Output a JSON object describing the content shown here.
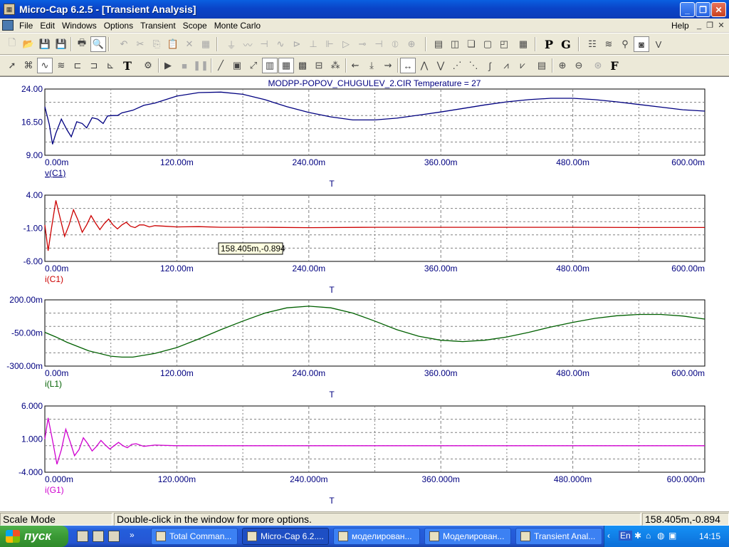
{
  "window": {
    "title": "Micro-Cap 6.2.5 - [Transient Analysis]",
    "app_icon": "microcap-app-icon",
    "controls": [
      "minimize-icon",
      "restore-icon",
      "close-icon"
    ]
  },
  "menu": {
    "items": [
      "File",
      "Edit",
      "Windows",
      "Options",
      "Transient",
      "Scope",
      "Monte Carlo"
    ],
    "help": "Help",
    "mdi_controls": [
      "minimize-icon",
      "restore-icon",
      "close-icon"
    ]
  },
  "toolbar1": {
    "letters": [
      "P",
      "G"
    ]
  },
  "toolbar2": {
    "letters": [
      "T",
      "F"
    ]
  },
  "plot": {
    "title": "MODPP-POPOV_CHUGULEV_2.CIR Temperature = 27",
    "tooltip": "158.405m,-0.894",
    "background": "#ffffff",
    "grid_color": "#808080",
    "axis_label_color": "#000080"
  },
  "chart_data": [
    {
      "type": "line",
      "series": [
        {
          "name": "v(C1)",
          "color": "#000080"
        }
      ],
      "x_label": "T",
      "x_ticks": [
        "0.00m",
        "120.00m",
        "240.00m",
        "360.00m",
        "480.00m",
        "600.00m"
      ],
      "y_ticks": [
        "24.00",
        "16.50",
        "9.00"
      ],
      "xlim": [
        0,
        600
      ],
      "ylim": [
        9,
        24
      ],
      "points": [
        [
          0,
          20
        ],
        [
          4,
          16
        ],
        [
          7,
          11.5
        ],
        [
          10,
          14
        ],
        [
          15,
          17.2
        ],
        [
          20,
          14.8
        ],
        [
          24,
          13.2
        ],
        [
          29,
          16.6
        ],
        [
          34,
          16.2
        ],
        [
          38,
          15.2
        ],
        [
          43,
          17.5
        ],
        [
          48,
          17.2
        ],
        [
          53,
          16.2
        ],
        [
          57,
          17.9
        ],
        [
          62,
          18
        ],
        [
          66,
          18
        ],
        [
          70,
          18.6
        ],
        [
          80,
          19.2
        ],
        [
          90,
          20.3
        ],
        [
          100,
          20.8
        ],
        [
          120,
          22.4
        ],
        [
          140,
          23.2
        ],
        [
          160,
          23.3
        ],
        [
          180,
          22.8
        ],
        [
          200,
          21.6
        ],
        [
          220,
          20
        ],
        [
          240,
          18.7
        ],
        [
          260,
          17.7
        ],
        [
          280,
          17
        ],
        [
          300,
          17
        ],
        [
          320,
          17.4
        ],
        [
          340,
          18.1
        ],
        [
          360,
          18.8
        ],
        [
          380,
          19.6
        ],
        [
          400,
          20.4
        ],
        [
          420,
          21.1
        ],
        [
          440,
          21.6
        ],
        [
          460,
          21.9
        ],
        [
          480,
          21.9
        ],
        [
          500,
          21.6
        ],
        [
          520,
          21.1
        ],
        [
          540,
          20.5
        ],
        [
          560,
          19.9
        ],
        [
          580,
          19.3
        ],
        [
          600,
          19
        ]
      ]
    },
    {
      "type": "line",
      "series": [
        {
          "name": "i(C1)",
          "color": "#cc0000"
        }
      ],
      "x_label": "T",
      "x_ticks": [
        "0.00m",
        "120.00m",
        "240.00m",
        "360.00m",
        "480.00m",
        "600.00m"
      ],
      "y_ticks": [
        "4.00",
        "-1.00",
        "-6.00"
      ],
      "xlim": [
        0,
        600
      ],
      "ylim": [
        -6,
        4
      ],
      "points": [
        [
          0,
          -0.5
        ],
        [
          3,
          -4.4
        ],
        [
          6,
          -1
        ],
        [
          10,
          3.2
        ],
        [
          14,
          0.5
        ],
        [
          18,
          -2.2
        ],
        [
          22,
          -0.5
        ],
        [
          26,
          1.8
        ],
        [
          30,
          0.3
        ],
        [
          34,
          -1.6
        ],
        [
          38,
          -0.5
        ],
        [
          42,
          0.9
        ],
        [
          46,
          -0.2
        ],
        [
          50,
          -1.2
        ],
        [
          54,
          -0.3
        ],
        [
          58,
          0.4
        ],
        [
          62,
          -0.5
        ],
        [
          66,
          -1.1
        ],
        [
          70,
          -0.5
        ],
        [
          74,
          -0.1
        ],
        [
          78,
          -0.7
        ],
        [
          82,
          -0.9
        ],
        [
          86,
          -0.5
        ],
        [
          90,
          -0.5
        ],
        [
          95,
          -0.8
        ],
        [
          100,
          -0.6
        ],
        [
          110,
          -0.7
        ],
        [
          120,
          -0.8
        ],
        [
          140,
          -0.75
        ],
        [
          160,
          -0.85
        ],
        [
          200,
          -0.85
        ],
        [
          240,
          -0.9
        ],
        [
          300,
          -0.85
        ],
        [
          360,
          -0.85
        ],
        [
          420,
          -0.85
        ],
        [
          480,
          -0.85
        ],
        [
          540,
          -0.88
        ],
        [
          600,
          -0.88
        ]
      ]
    },
    {
      "type": "line",
      "series": [
        {
          "name": "i(L1)",
          "color": "#006000"
        }
      ],
      "x_label": "T",
      "x_ticks": [
        "0.00m",
        "120.00m",
        "240.00m",
        "360.00m",
        "480.00m",
        "600.00m"
      ],
      "y_ticks": [
        "200.00m",
        "-50.00m",
        "-300.00m"
      ],
      "xlim": [
        0,
        600
      ],
      "ylim": [
        -300,
        200
      ],
      "points": [
        [
          0,
          -45
        ],
        [
          10,
          -80
        ],
        [
          20,
          -120
        ],
        [
          40,
          -185
        ],
        [
          60,
          -225
        ],
        [
          70,
          -232
        ],
        [
          80,
          -232
        ],
        [
          100,
          -205
        ],
        [
          120,
          -160
        ],
        [
          140,
          -95
        ],
        [
          160,
          -25
        ],
        [
          180,
          40
        ],
        [
          200,
          100
        ],
        [
          220,
          140
        ],
        [
          240,
          152
        ],
        [
          260,
          140
        ],
        [
          280,
          100
        ],
        [
          300,
          40
        ],
        [
          320,
          -25
        ],
        [
          340,
          -75
        ],
        [
          360,
          -105
        ],
        [
          380,
          -115
        ],
        [
          400,
          -105
        ],
        [
          420,
          -80
        ],
        [
          440,
          -45
        ],
        [
          460,
          -5
        ],
        [
          480,
          30
        ],
        [
          500,
          60
        ],
        [
          520,
          80
        ],
        [
          540,
          90
        ],
        [
          560,
          90
        ],
        [
          580,
          78
        ],
        [
          600,
          55
        ]
      ]
    },
    {
      "type": "line",
      "series": [
        {
          "name": "i(G1)",
          "color": "#d000d0"
        }
      ],
      "x_label": "T",
      "x_ticks": [
        "0.000m",
        "120.000m",
        "240.000m",
        "360.000m",
        "480.000m",
        "600.000m"
      ],
      "y_ticks": [
        "6.000",
        "1.000",
        "-4.000"
      ],
      "xlim": [
        0,
        600
      ],
      "ylim": [
        -4,
        6
      ],
      "points": [
        [
          0,
          1
        ],
        [
          3,
          4.2
        ],
        [
          7,
          0.8
        ],
        [
          11,
          -2.8
        ],
        [
          15,
          -0.6
        ],
        [
          19,
          2.5
        ],
        [
          23,
          0.6
        ],
        [
          27,
          -1.5
        ],
        [
          31,
          -0.6
        ],
        [
          35,
          1.2
        ],
        [
          39,
          0.3
        ],
        [
          43,
          -0.8
        ],
        [
          47,
          -0.1
        ],
        [
          51,
          0.8
        ],
        [
          55,
          0.1
        ],
        [
          59,
          -0.5
        ],
        [
          63,
          0
        ],
        [
          67,
          0.5
        ],
        [
          71,
          0
        ],
        [
          75,
          -0.3
        ],
        [
          79,
          0.2
        ],
        [
          83,
          0.3
        ],
        [
          90,
          -0.1
        ],
        [
          100,
          0.1
        ],
        [
          120,
          0
        ],
        [
          160,
          0
        ],
        [
          240,
          0
        ],
        [
          360,
          0
        ],
        [
          480,
          0
        ],
        [
          600,
          0
        ]
      ]
    }
  ],
  "status": {
    "mode": "Scale Mode",
    "hint": "Double-click in the window for more options.",
    "coords": "158.405m,-0.894"
  },
  "taskbar": {
    "start": "пуск",
    "tasks": [
      {
        "label": "Total Comman..."
      },
      {
        "label": "Micro-Cap 6.2...."
      },
      {
        "label": "моделирован..."
      },
      {
        "label": "Моделирован..."
      },
      {
        "label": "Transient Anal..."
      }
    ],
    "lang": "En",
    "clock": "14:15"
  }
}
